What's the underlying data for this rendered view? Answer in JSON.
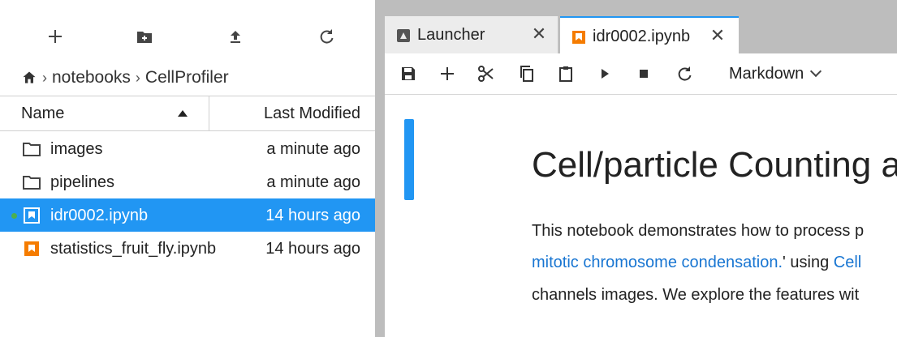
{
  "file_browser": {
    "toolbar": [
      "new-launcher",
      "new-folder",
      "upload",
      "refresh"
    ],
    "breadcrumb": [
      "notebooks",
      "CellProfiler"
    ],
    "columns": {
      "name": "Name",
      "last_modified": "Last Modified"
    },
    "items": [
      {
        "name": "images",
        "modified": "a minute ago",
        "type": "folder"
      },
      {
        "name": "pipelines",
        "modified": "a minute ago",
        "type": "folder"
      },
      {
        "name": "idr0002.ipynb",
        "modified": "14 hours ago",
        "type": "notebook",
        "selected": true,
        "running": true
      },
      {
        "name": "statistics_fruit_fly.ipynb",
        "modified": "14 hours ago",
        "type": "notebook"
      }
    ]
  },
  "tabs": [
    {
      "label": "Launcher",
      "icon": "launcher-icon",
      "active": false
    },
    {
      "label": "idr0002.ipynb",
      "icon": "notebook-icon",
      "active": true
    }
  ],
  "notebook_toolbar": {
    "icons": [
      "save-icon",
      "add-icon",
      "cut-icon",
      "copy-icon",
      "paste-icon",
      "run-icon",
      "stop-icon",
      "restart-icon"
    ],
    "cell_type": "Markdown"
  },
  "notebook": {
    "title": "Cell/particle Counting a",
    "line1": "This notebook demonstrates how to process p",
    "line2_link1": "mitotic chromosome condensation.",
    "line2_mid": "' using ",
    "line2_link2": "Cell",
    "line3": "channels images. We explore the features wit"
  },
  "colors": {
    "accent": "#2196f3",
    "notebook_orange": "#f57c00",
    "link": "#1976d2",
    "chrome": "#bdbdbd",
    "running": "#4caf50"
  }
}
